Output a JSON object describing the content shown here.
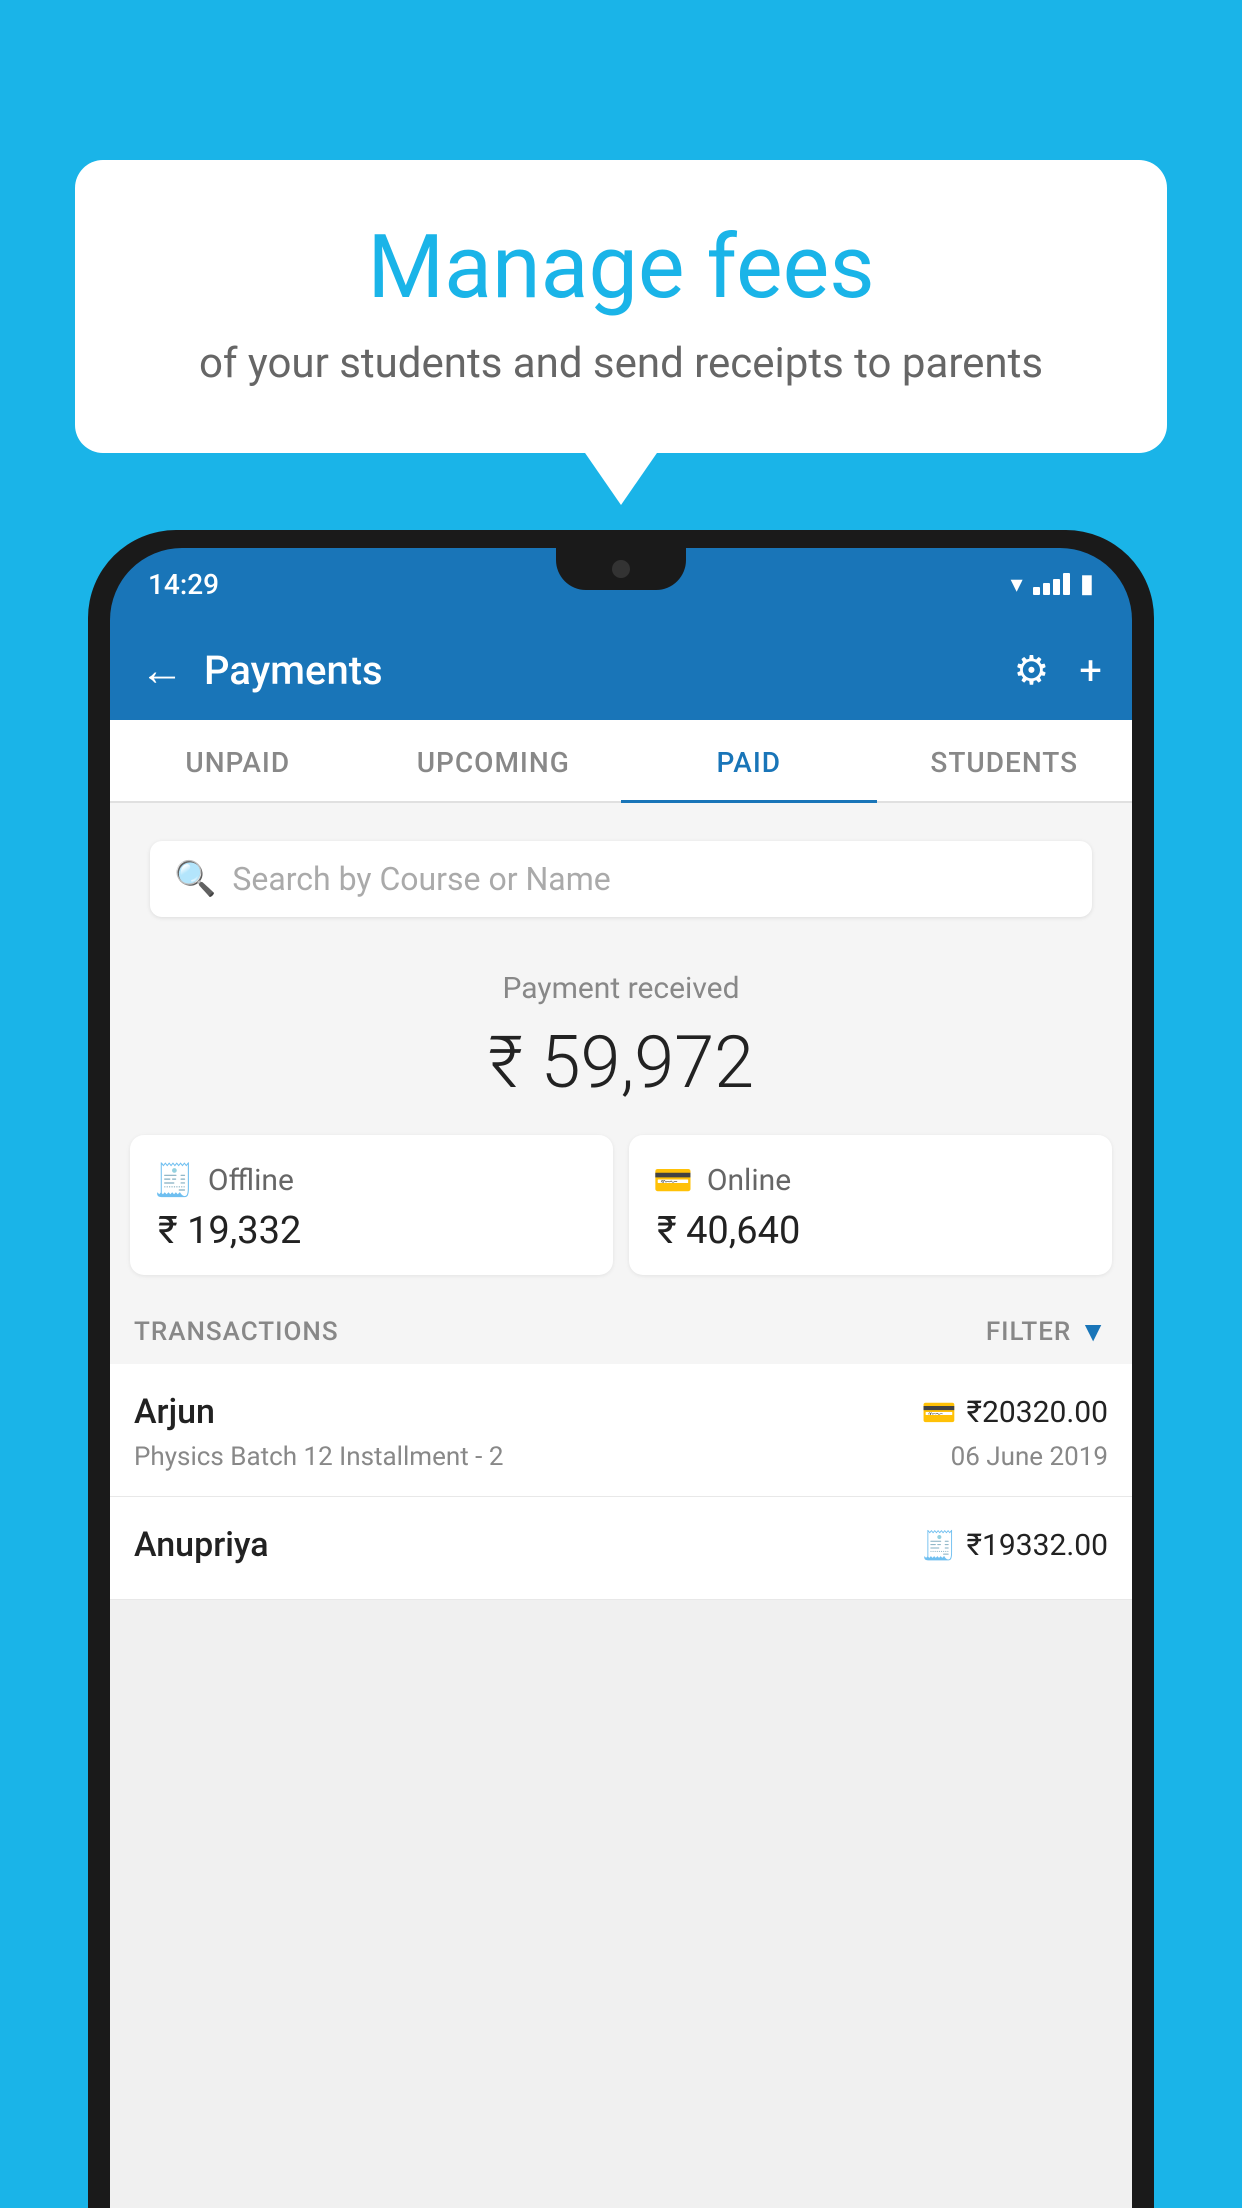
{
  "background_color": "#1ab4e8",
  "speech_bubble": {
    "title": "Manage fees",
    "subtitle": "of your students and send receipts to parents"
  },
  "status_bar": {
    "time": "14:29",
    "wifi": "▼",
    "battery": "▐"
  },
  "header": {
    "title": "Payments",
    "back_label": "←",
    "gear_label": "⚙",
    "plus_label": "+"
  },
  "tabs": [
    {
      "label": "UNPAID",
      "active": false
    },
    {
      "label": "UPCOMING",
      "active": false
    },
    {
      "label": "PAID",
      "active": true
    },
    {
      "label": "STUDENTS",
      "active": false
    }
  ],
  "search": {
    "placeholder": "Search by Course or Name"
  },
  "payment_summary": {
    "label": "Payment received",
    "amount": "₹ 59,972",
    "offline_label": "Offline",
    "offline_amount": "₹ 19,332",
    "online_label": "Online",
    "online_amount": "₹ 40,640"
  },
  "transactions_section": {
    "label": "TRANSACTIONS",
    "filter_label": "FILTER"
  },
  "transactions": [
    {
      "name": "Arjun",
      "icon": "card",
      "amount": "₹20320.00",
      "course": "Physics Batch 12 Installment - 2",
      "date": "06 June 2019"
    },
    {
      "name": "Anupriya",
      "icon": "cash",
      "amount": "₹19332.00",
      "course": "",
      "date": ""
    }
  ]
}
